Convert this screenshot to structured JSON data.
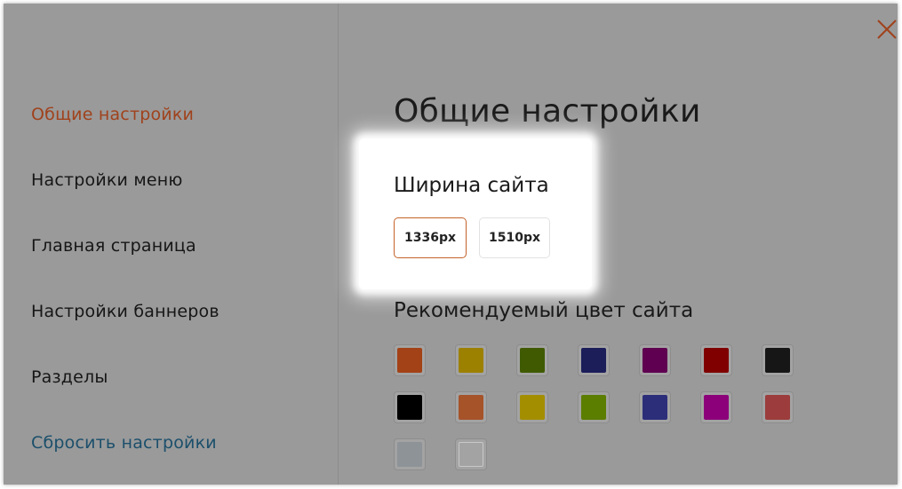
{
  "sidebar": {
    "items": [
      {
        "label": "Общие настройки",
        "active": true
      },
      {
        "label": "Настройки меню"
      },
      {
        "label": "Главная страница"
      },
      {
        "label": "Настройки баннеров"
      },
      {
        "label": "Разделы"
      }
    ],
    "reset_label": "Сбросить настройки"
  },
  "close_icon": "close-icon",
  "main": {
    "title": "Общие настройки",
    "site_width": {
      "label": "Ширина сайта",
      "options": [
        "1336px",
        "1510px"
      ],
      "selected": "1336px"
    },
    "color": {
      "label": "Рекомендуемый цвет сайта",
      "swatches": [
        "#a34216",
        "#9c8000",
        "#3f5a00",
        "#1c1e5a",
        "#5f0050",
        "#800000",
        "#161616",
        "#000000",
        "#a6532a",
        "#a38e00",
        "#5b7d00",
        "#2c2e7a",
        "#8c007a",
        "#9c3c3c",
        "#8e9398",
        "#a3a3a3"
      ]
    }
  },
  "colors": {
    "overlay": "#9a9a9a",
    "active_item": "#a0421c",
    "reset_link": "#1b4f6b",
    "selected_border": "#c4622a"
  }
}
